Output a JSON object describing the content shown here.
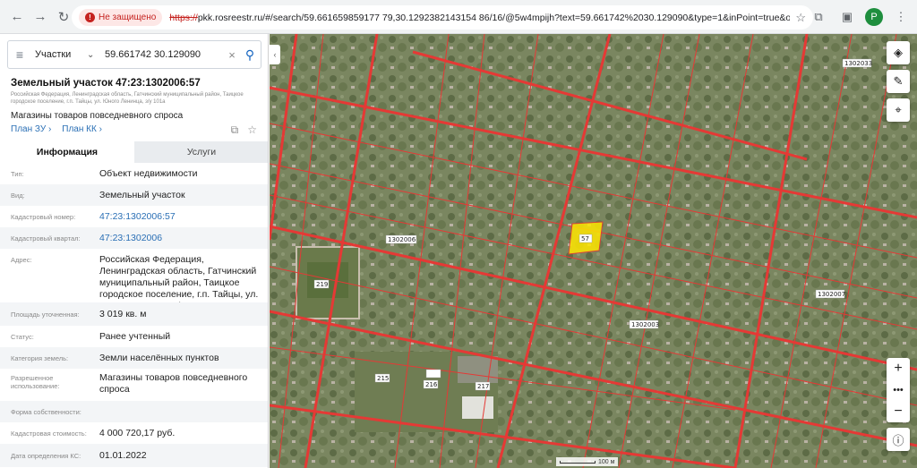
{
  "browser": {
    "insecure_label": "Не защищено",
    "url_scheme": "https://",
    "url_rest": "pkk.rosreestr.ru/#/search/59.661659859177 79,30.1292382143154 86/16/@5w4mpijh?text=59.661742%2030.129090&type=1&inPoint=true&opened=47%3A23%3A...",
    "profile_initial": "P"
  },
  "search": {
    "type_label": "Участки",
    "value": "59.661742 30.129090"
  },
  "parcel": {
    "title": "Земельный участок 47:23:1302006:57",
    "address_small": "Российская Федерация, Ленинградская область, Гатчинский муниципальный район, Таицкое городское поселение, г.п. Тайцы, ул. Юного Ленинца, з/у 101а",
    "purpose": "Магазины товаров повседневного спроса",
    "plan_zu": "План ЗУ",
    "plan_kk": "План КК"
  },
  "tabs": {
    "info": "Информация",
    "services": "Услуги"
  },
  "info": {
    "type_label": "Тип:",
    "type_value": "Объект недвижимости",
    "kind_label": "Вид:",
    "kind_value": "Земельный участок",
    "cadnum_label": "Кадастровый номер:",
    "cadnum_value": "47:23:1302006:57",
    "quarter_label": "Кадастровый квартал:",
    "quarter_value": "47:23:1302006",
    "address_label": "Адрес:",
    "address_value": "Российская Федерация, Ленинградская область, Гатчинский муниципальный район, Таицкое городское поселение, г.п. Тайцы, ул. Юного Ленинца, з/у 101а",
    "area_label": "Площадь уточненная:",
    "area_value": "3 019 кв. м",
    "status_label": "Статус:",
    "status_value": "Ранее учтенный",
    "category_label": "Категория земель:",
    "category_value": "Земли населённых пунктов",
    "use_label": "Разрешенное использование:",
    "use_value": "Магазины товаров повседневного спроса",
    "ownership_label": "Форма собственности:",
    "ownership_value": "",
    "cost_label": "Кадастровая стоимость:",
    "cost_value": "4 000 720,17 руб.",
    "cost_date_label": "Дата определения КС:",
    "cost_date_value": "01.01.2022"
  },
  "map": {
    "labels": {
      "highlight": "57",
      "quarter_a": "1302006",
      "quarter_b": "1302007",
      "quarter_c": "1302003",
      "quarter_d": "1302033",
      "parcel_219": "219",
      "parcel_216": "216",
      "parcel_217": "217",
      "parcel_215": "215"
    },
    "scale_label": "100 м"
  }
}
